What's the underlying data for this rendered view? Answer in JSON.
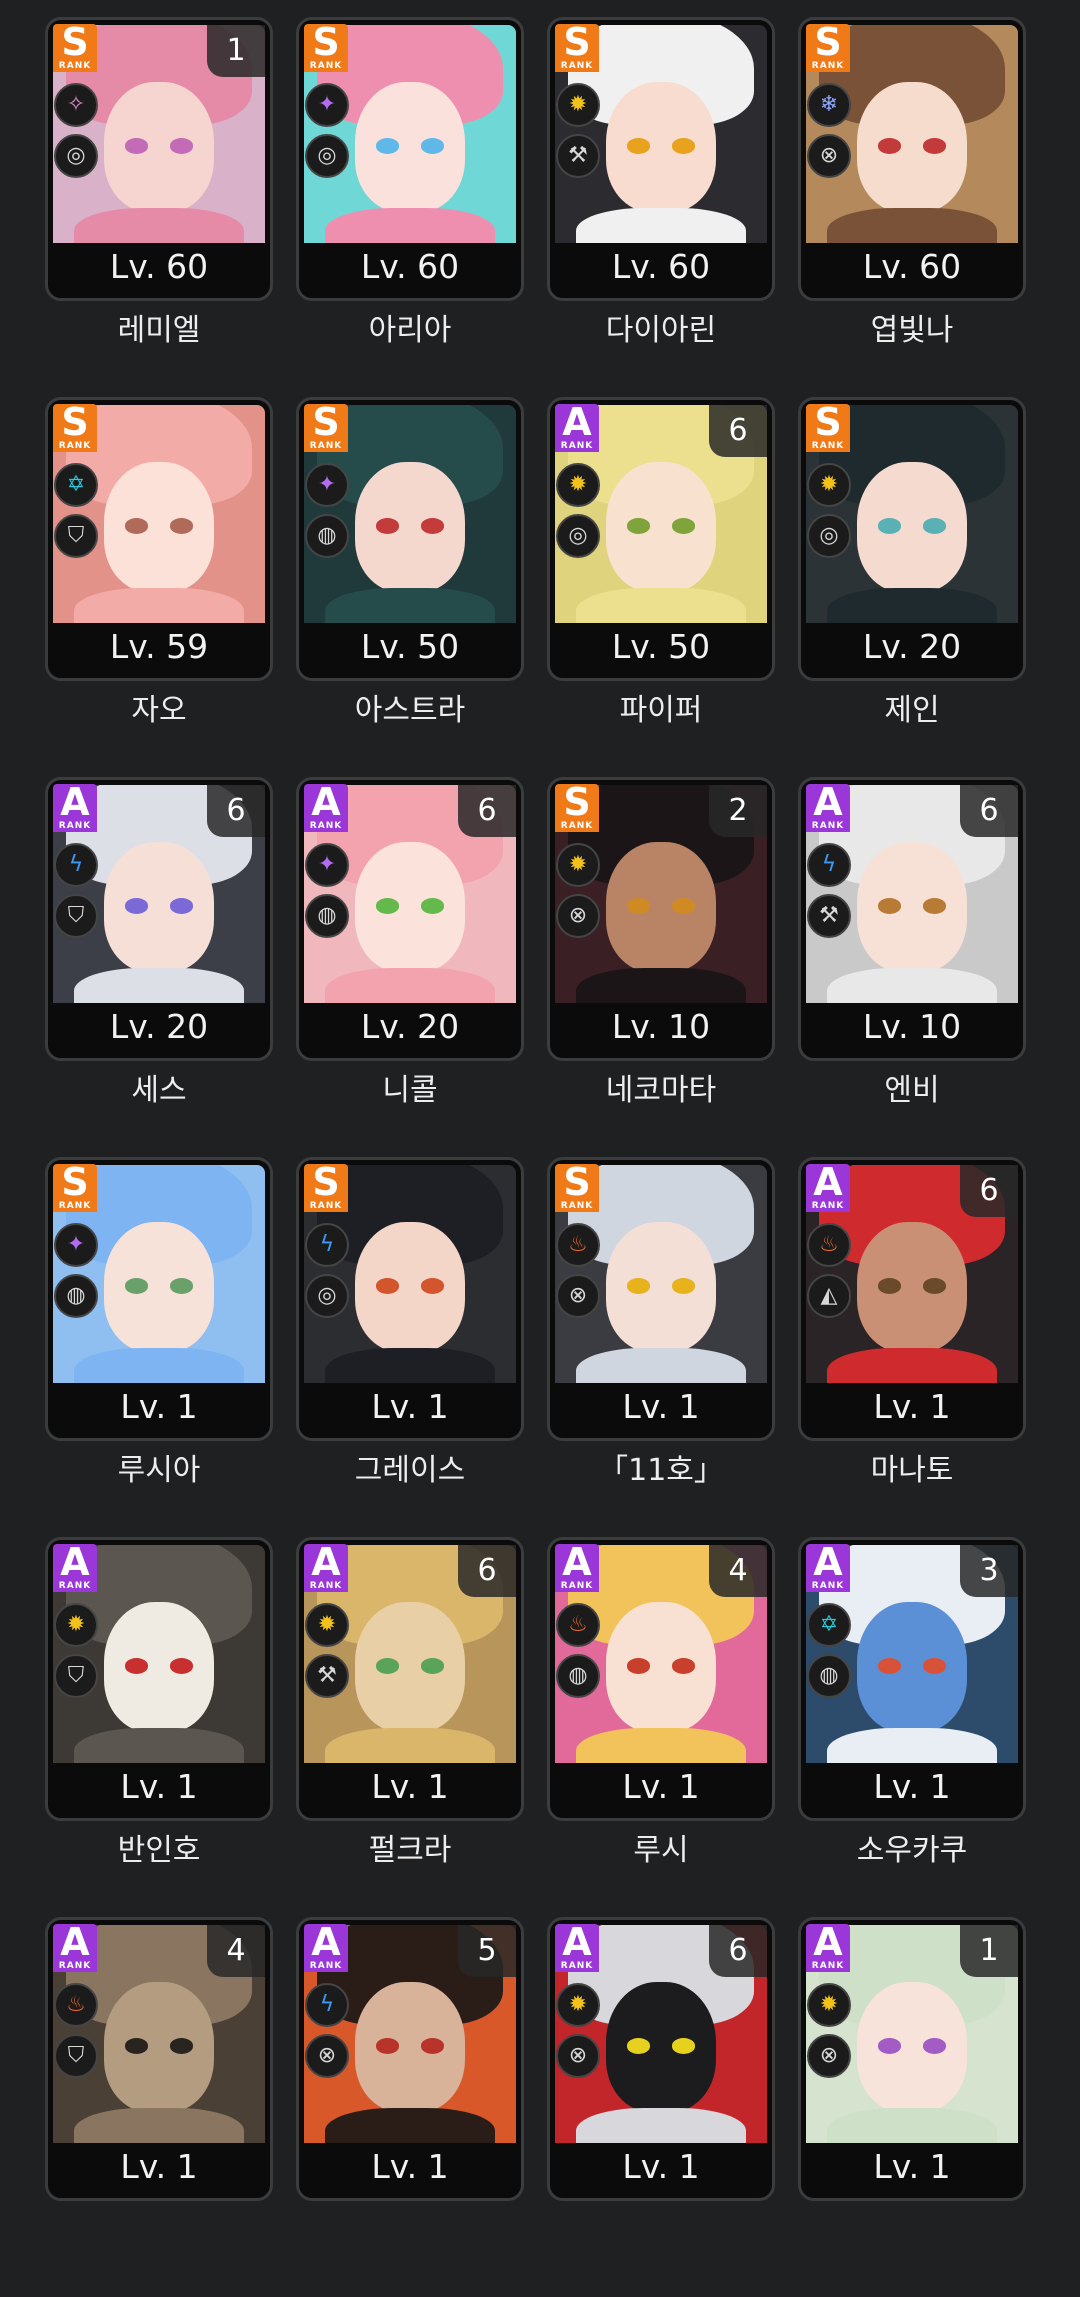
{
  "characters": [
    {
      "name": "레미엘",
      "level": "Lv. 60",
      "rank": "S",
      "rank_word": "RANK",
      "mind": "1",
      "attribute_icon": "ether-icon",
      "attr_color": "#e08cc8",
      "attr_glyph": "✧",
      "specialty_icon": "attack-icon",
      "spec_glyph": "◎",
      "hair": "#e58ba8",
      "skin": "#f6d4cf",
      "bg": "#d9b2c9",
      "eye": "#c46bb8"
    },
    {
      "name": "아리아",
      "level": "Lv. 60",
      "rank": "S",
      "rank_word": "RANK",
      "mind": "",
      "attribute_icon": "ether-icon",
      "attr_color": "#b36cf0",
      "attr_glyph": "✦",
      "specialty_icon": "anomaly-icon",
      "spec_glyph": "◎",
      "hair": "#ef8fb0",
      "skin": "#fbe1dc",
      "bg": "#6fd7d6",
      "eye": "#5fb8e8"
    },
    {
      "name": "다이아린",
      "level": "Lv. 60",
      "rank": "S",
      "rank_word": "RANK",
      "mind": "",
      "attribute_icon": "physical-icon",
      "attr_color": "#f2c21a",
      "attr_glyph": "✹",
      "specialty_icon": "defense-icon",
      "spec_glyph": "⚒",
      "hair": "#f0f0f0",
      "skin": "#f7dccf",
      "bg": "#2b2b30",
      "eye": "#e8a21d"
    },
    {
      "name": "엽빛나",
      "level": "Lv. 60",
      "rank": "S",
      "rank_word": "RANK",
      "mind": "",
      "attribute_icon": "ice-icon",
      "attr_color": "#8ca9ff",
      "attr_glyph": "❄",
      "specialty_icon": "stun-icon",
      "spec_glyph": "⊗",
      "hair": "#7a5238",
      "skin": "#f6dccd",
      "bg": "#b48a5c",
      "eye": "#c23a3a"
    },
    {
      "name": "자오",
      "level": "Lv. 59",
      "rank": "S",
      "rank_word": "RANK",
      "mind": "",
      "attribute_icon": "ice-icon",
      "attr_color": "#28cde0",
      "attr_glyph": "✡",
      "specialty_icon": "defense-icon",
      "spec_glyph": "⛉",
      "hair": "#f2aba6",
      "skin": "#fbe1d8",
      "bg": "#e3928a",
      "eye": "#b06a5a"
    },
    {
      "name": "아스트라",
      "level": "Lv. 50",
      "rank": "S",
      "rank_word": "RANK",
      "mind": "",
      "attribute_icon": "ether-icon",
      "attr_color": "#b36cf0",
      "attr_glyph": "✦",
      "specialty_icon": "support-icon",
      "spec_glyph": "◍",
      "hair": "#254b4a",
      "skin": "#f4d8cd",
      "bg": "#203a3c",
      "eye": "#c43b3b"
    },
    {
      "name": "파이퍼",
      "level": "Lv. 50",
      "rank": "A",
      "rank_word": "RANK",
      "mind": "6",
      "attribute_icon": "physical-icon",
      "attr_color": "#f2c21a",
      "attr_glyph": "✹",
      "specialty_icon": "anomaly-icon",
      "spec_glyph": "◎",
      "hair": "#ece08e",
      "skin": "#f8e1cf",
      "bg": "#e0d37e",
      "eye": "#7fa43b"
    },
    {
      "name": "제인",
      "level": "Lv. 20",
      "rank": "S",
      "rank_word": "RANK",
      "mind": "",
      "attribute_icon": "physical-icon",
      "attr_color": "#f2c21a",
      "attr_glyph": "✹",
      "specialty_icon": "anomaly-icon",
      "spec_glyph": "◎",
      "hair": "#1f2a2e",
      "skin": "#f4dacf",
      "bg": "#2b3336",
      "eye": "#59b0b5"
    },
    {
      "name": "세스",
      "level": "Lv. 20",
      "rank": "A",
      "rank_word": "RANK",
      "mind": "6",
      "attribute_icon": "electric-icon",
      "attr_color": "#3a9af5",
      "attr_glyph": "ϟ",
      "specialty_icon": "defense-icon",
      "spec_glyph": "⛉",
      "hair": "#dcdfe6",
      "skin": "#f6dfd6",
      "bg": "#3c3f48",
      "eye": "#7a69d6"
    },
    {
      "name": "니콜",
      "level": "Lv. 20",
      "rank": "A",
      "rank_word": "RANK",
      "mind": "6",
      "attribute_icon": "ether-icon",
      "attr_color": "#b36cf0",
      "attr_glyph": "✦",
      "specialty_icon": "support-icon",
      "spec_glyph": "◍",
      "hair": "#f2a3ae",
      "skin": "#fbe2da",
      "bg": "#f0b7bc",
      "eye": "#63b94b"
    },
    {
      "name": "네코마타",
      "level": "Lv. 10",
      "rank": "S",
      "rank_word": "RANK",
      "mind": "2",
      "attribute_icon": "physical-icon",
      "attr_color": "#f2c21a",
      "attr_glyph": "✹",
      "specialty_icon": "attack-icon",
      "spec_glyph": "⊗",
      "hair": "#1b1517",
      "skin": "#b98466",
      "bg": "#3a2024",
      "eye": "#d08a24"
    },
    {
      "name": "엔비",
      "level": "Lv. 10",
      "rank": "A",
      "rank_word": "RANK",
      "mind": "6",
      "attribute_icon": "electric-icon",
      "attr_color": "#3a9af5",
      "attr_glyph": "ϟ",
      "specialty_icon": "stun-icon",
      "spec_glyph": "⚒",
      "hair": "#e8e8e8",
      "skin": "#f7e1d6",
      "bg": "#c9c9c9",
      "eye": "#b87b35"
    },
    {
      "name": "루시아",
      "level": "Lv. 1",
      "rank": "S",
      "rank_word": "RANK",
      "mind": "",
      "attribute_icon": "ether-icon",
      "attr_color": "#b36cf0",
      "attr_glyph": "✦",
      "specialty_icon": "support-icon",
      "spec_glyph": "◍",
      "hair": "#7fb4f2",
      "skin": "#f7e2d9",
      "bg": "#8fbff0",
      "eye": "#6aa06a"
    },
    {
      "name": "그레이스",
      "level": "Lv. 1",
      "rank": "S",
      "rank_word": "RANK",
      "mind": "",
      "attribute_icon": "electric-icon",
      "attr_color": "#3a9af5",
      "attr_glyph": "ϟ",
      "specialty_icon": "anomaly-icon",
      "spec_glyph": "◎",
      "hair": "#1d1f24",
      "skin": "#f3d6c8",
      "bg": "#2c2d31",
      "eye": "#d2552c"
    },
    {
      "name": "「11호」",
      "level": "Lv. 1",
      "rank": "S",
      "rank_word": "RANK",
      "mind": "",
      "attribute_icon": "fire-icon",
      "attr_color": "#f06a30",
      "attr_glyph": "♨",
      "specialty_icon": "attack-icon",
      "spec_glyph": "⊗",
      "hair": "#cfd6e0",
      "skin": "#f4dfd6",
      "bg": "#3a3c42",
      "eye": "#e8b21d"
    },
    {
      "name": "마나토",
      "level": "Lv. 1",
      "rank": "A",
      "rank_word": "RANK",
      "mind": "6",
      "attribute_icon": "fire-icon",
      "attr_color": "#f06a30",
      "attr_glyph": "♨",
      "specialty_icon": "rupture-icon",
      "spec_glyph": "◭",
      "hair": "#cf2a2e",
      "skin": "#c99076",
      "bg": "#2a2426",
      "eye": "#6a4a2a"
    },
    {
      "name": "반인호",
      "level": "Lv. 1",
      "rank": "A",
      "rank_word": "RANK",
      "mind": "",
      "attribute_icon": "physical-icon",
      "attr_color": "#f2c21a",
      "attr_glyph": "✹",
      "specialty_icon": "defense-icon",
      "spec_glyph": "⛉",
      "hair": "#5b5650",
      "skin": "#f0ebe2",
      "bg": "#3d3a36",
      "eye": "#c7302f"
    },
    {
      "name": "펄크라",
      "level": "Lv. 1",
      "rank": "A",
      "rank_word": "RANK",
      "mind": "6",
      "attribute_icon": "physical-icon",
      "attr_color": "#f2c21a",
      "attr_glyph": "✹",
      "specialty_icon": "stun-icon",
      "spec_glyph": "⚒",
      "hair": "#d9b66a",
      "skin": "#e8cfa5",
      "bg": "#b8955a",
      "eye": "#5aa35a"
    },
    {
      "name": "루시",
      "level": "Lv. 1",
      "rank": "A",
      "rank_word": "RANK",
      "mind": "4",
      "attribute_icon": "fire-icon",
      "attr_color": "#f06a30",
      "attr_glyph": "♨",
      "specialty_icon": "support-icon",
      "spec_glyph": "◍",
      "hair": "#f2c35a",
      "skin": "#f8e0d2",
      "bg": "#e26a9a",
      "eye": "#c8402c"
    },
    {
      "name": "소우카쿠",
      "level": "Lv. 1",
      "rank": "A",
      "rank_word": "RANK",
      "mind": "3",
      "attribute_icon": "ice-icon",
      "attr_color": "#28cde0",
      "attr_glyph": "✡",
      "specialty_icon": "support-icon",
      "spec_glyph": "◍",
      "hair": "#e8eef4",
      "skin": "#5b8fd6",
      "bg": "#2d4b6a",
      "eye": "#d8523a"
    },
    {
      "name": "",
      "level": "Lv. 1",
      "rank": "A",
      "rank_word": "RANK",
      "mind": "4",
      "attribute_icon": "fire-icon",
      "attr_color": "#f06a30",
      "attr_glyph": "♨",
      "specialty_icon": "defense-icon",
      "spec_glyph": "⛉",
      "hair": "#8a7660",
      "skin": "#b49c80",
      "bg": "#4a4036",
      "eye": "#2a2420"
    },
    {
      "name": "",
      "level": "Lv. 1",
      "rank": "A",
      "rank_word": "RANK",
      "mind": "5",
      "attribute_icon": "electric-icon",
      "attr_color": "#3a9af5",
      "attr_glyph": "ϟ",
      "specialty_icon": "attack-icon",
      "spec_glyph": "⊗",
      "hair": "#2a1d18",
      "skin": "#d9b29a",
      "bg": "#d8582a",
      "eye": "#b8342a"
    },
    {
      "name": "",
      "level": "Lv. 1",
      "rank": "A",
      "rank_word": "RANK",
      "mind": "6",
      "attribute_icon": "physical-icon",
      "attr_color": "#f2c21a",
      "attr_glyph": "✹",
      "specialty_icon": "attack-icon",
      "spec_glyph": "⊗",
      "hair": "#d8d8dc",
      "skin": "#1c1c1e",
      "bg": "#c2262a",
      "eye": "#e6d21e"
    },
    {
      "name": "",
      "level": "Lv. 1",
      "rank": "A",
      "rank_word": "RANK",
      "mind": "1",
      "attribute_icon": "physical-icon",
      "attr_color": "#f2c21a",
      "attr_glyph": "✹",
      "specialty_icon": "attack-icon",
      "spec_glyph": "⊗",
      "hair": "#cfe0c8",
      "skin": "#f7e3da",
      "bg": "#d6e3cf",
      "eye": "#a35cc4"
    }
  ]
}
